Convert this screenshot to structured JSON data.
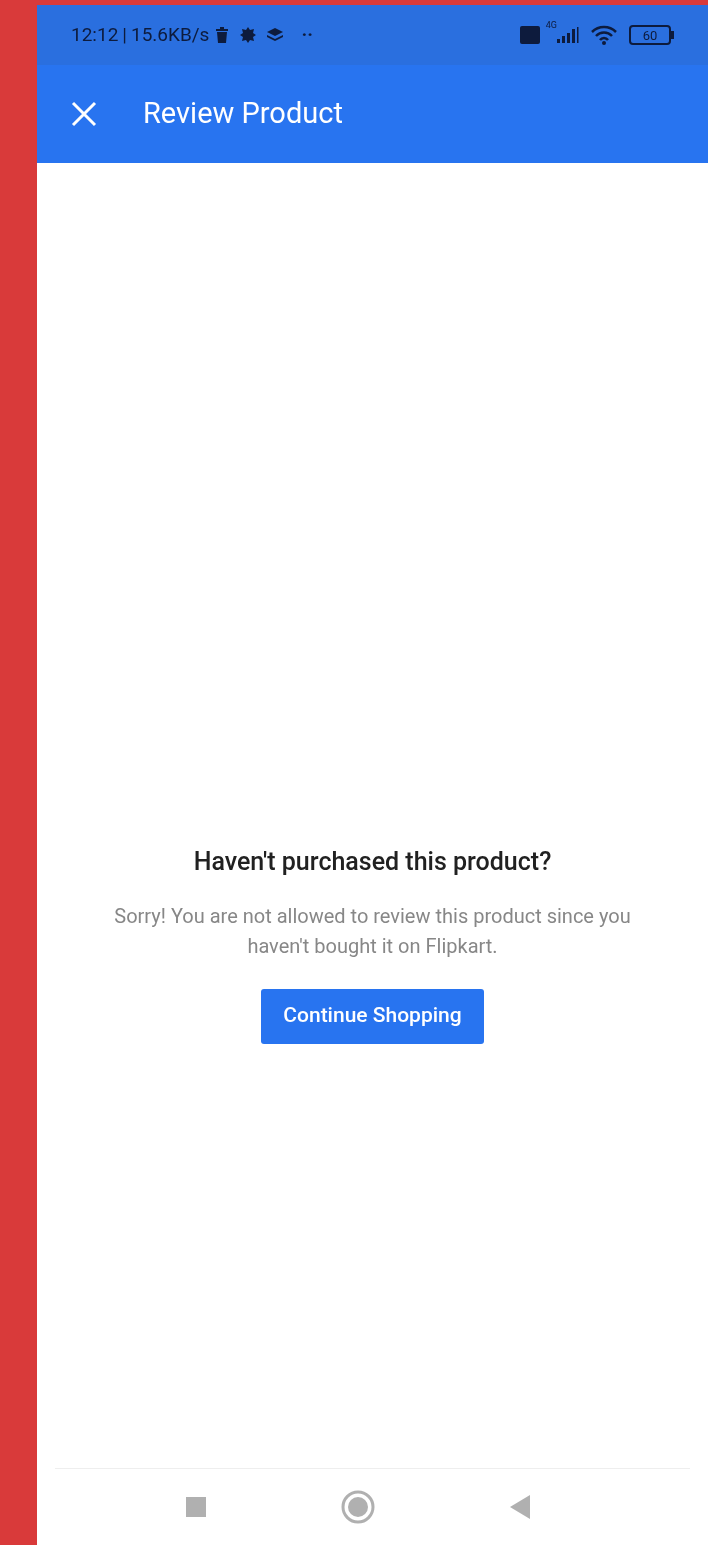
{
  "status_bar": {
    "time": "12:12",
    "separator": "|",
    "speed": "15.6KB/s",
    "more": "··",
    "network": "4G",
    "battery": "60"
  },
  "app_bar": {
    "title": "Review Product"
  },
  "message": {
    "title": "Haven't purchased this product?",
    "body": "Sorry! You are not allowed to review this product since you haven't bought it on Flipkart.",
    "button": "Continue Shopping"
  }
}
